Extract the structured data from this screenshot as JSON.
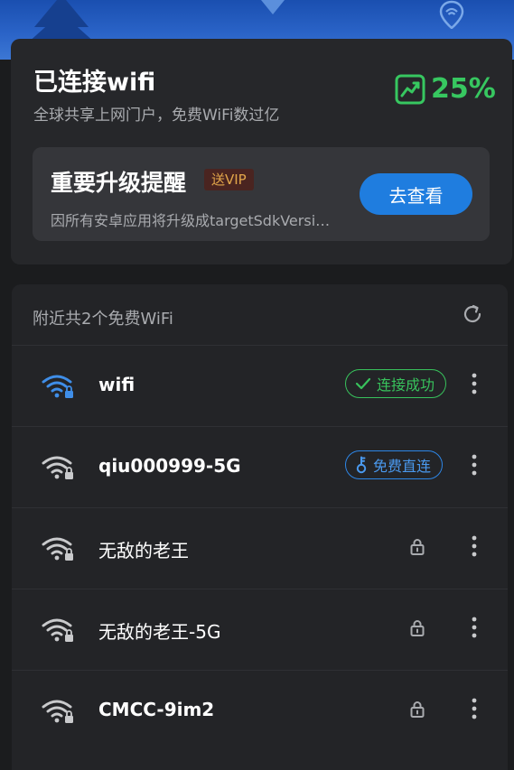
{
  "header": {
    "title": "已连接wifi",
    "subtitle": "全球共享上网门户，免费WiFi数过亿",
    "percent": "25%"
  },
  "notice": {
    "title": "重要升级提醒",
    "badge": "送VIP",
    "description": "因所有安卓应用将升级成targetSdkVersi…",
    "button": "去查看"
  },
  "list": {
    "header": "附近共2个免费WiFi",
    "items": [
      {
        "ssid": "wifi",
        "status": "连接成功",
        "status_type": "connected",
        "signal_color": "#3f8ee8"
      },
      {
        "ssid": "qiu000999-5G",
        "status": "免费直连",
        "status_type": "free",
        "signal_color": "#c9cacc"
      },
      {
        "ssid": "无敌的老王",
        "status_type": "locked",
        "signal_color": "#c9cacc"
      },
      {
        "ssid": "无敌的老王-5G",
        "status_type": "locked",
        "signal_color": "#c9cacc"
      },
      {
        "ssid": "CMCC-9im2",
        "status_type": "locked",
        "signal_color": "#c9cacc"
      }
    ]
  },
  "colors": {
    "accent_blue": "#1f7ddf",
    "success_green": "#38c25c",
    "background": "#1b1c1e",
    "card": "#26272a"
  },
  "icons": [
    "trend-chart-icon",
    "refresh-icon",
    "wifi-lock-icon",
    "check-icon",
    "key-icon",
    "lock-icon",
    "more-vertical-icon"
  ]
}
